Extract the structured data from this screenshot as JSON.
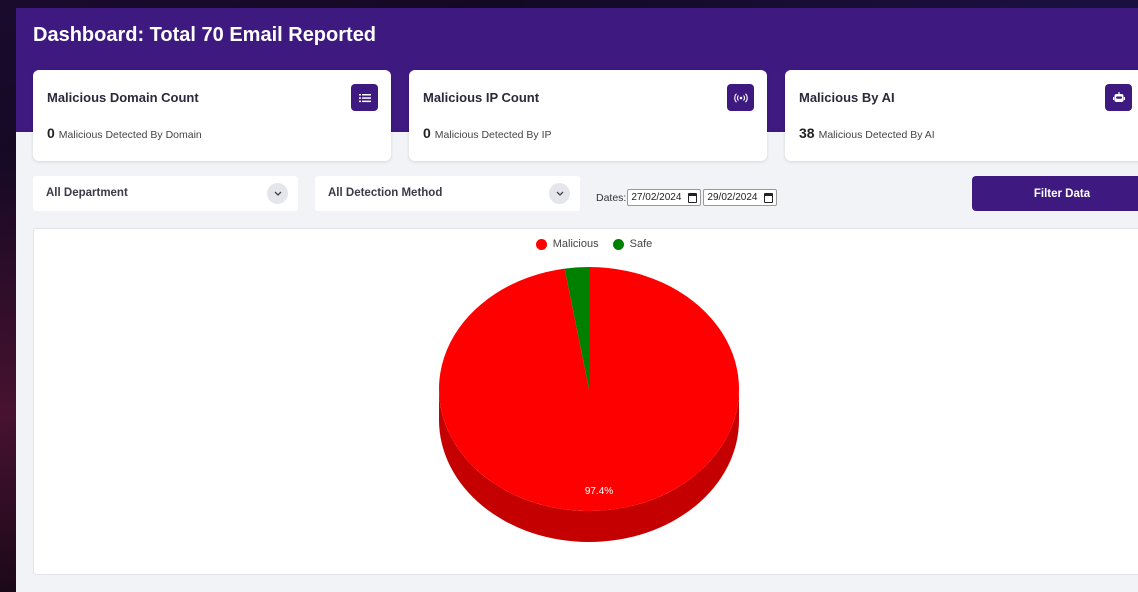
{
  "title": "Dashboard: Total 70 Email Reported",
  "cards": [
    {
      "title": "Malicious Domain Count",
      "count": "0",
      "label": "Malicious Detected By Domain",
      "icon": "list-icon"
    },
    {
      "title": "Malicious IP Count",
      "count": "0",
      "label": "Malicious Detected By IP",
      "icon": "broadcast-icon"
    },
    {
      "title": "Malicious By AI",
      "count": "38",
      "label": "Malicious Detected By AI",
      "icon": "robot-icon"
    }
  ],
  "filters": {
    "department": "All Department",
    "detection_method": "All Detection Method",
    "dates_label": "Dates:",
    "start_date": "27/02/2024",
    "end_date": "29/02/2024",
    "button": "Filter Data"
  },
  "colors": {
    "brand": "#3e1a80",
    "malicious": "#ff0000",
    "malicious_dark": "#c40000",
    "safe": "#008000"
  },
  "chart_data": {
    "type": "pie",
    "categories": [
      "Malicious",
      "Safe"
    ],
    "values": [
      97.4,
      2.6
    ],
    "data_labels": [
      "97.4%",
      ""
    ],
    "legend": "top-center",
    "style": "3d"
  }
}
